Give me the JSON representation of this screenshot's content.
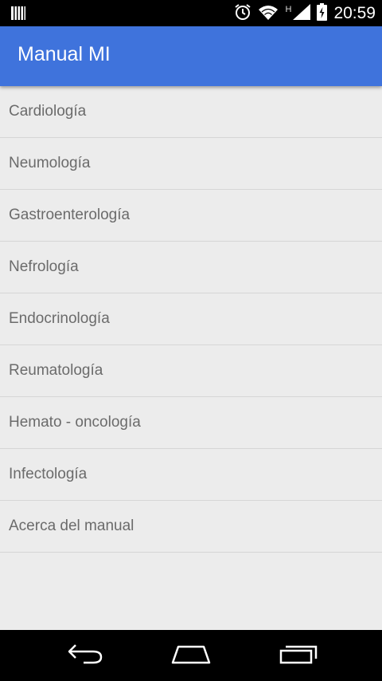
{
  "status_bar": {
    "time": "20:59",
    "network_type": "H",
    "icons": [
      "notification-icon",
      "alarm-icon",
      "wifi-icon",
      "signal-icon",
      "battery-charging-icon"
    ]
  },
  "app_bar": {
    "title": "Manual MI",
    "color": "#3f73dc"
  },
  "menu": {
    "items": [
      {
        "label": "Cardiología"
      },
      {
        "label": "Neumología"
      },
      {
        "label": "Gastroenterología"
      },
      {
        "label": "Nefrología"
      },
      {
        "label": "Endocrinología"
      },
      {
        "label": "Reumatología"
      },
      {
        "label": "Hemato - oncología"
      },
      {
        "label": "Infectología"
      },
      {
        "label": "Acerca del manual"
      }
    ]
  },
  "nav_bar": {
    "icons": [
      "back-icon",
      "home-icon",
      "recent-apps-icon"
    ]
  }
}
